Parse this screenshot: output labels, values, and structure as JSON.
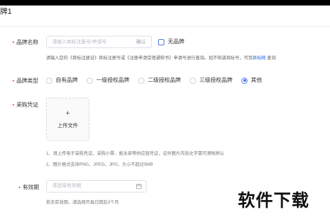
{
  "section": {
    "title": "牌1"
  },
  "brand_name": {
    "label": "品牌名称",
    "required": "•",
    "placeholder": "请输入商标注册号/申请号",
    "confirm_label": "确认",
    "no_brand_label": "无品牌",
    "help_text": "请输入您的《商标注册证》商标注册号或《注册申请受理通知书》申请号进行查询。如不知道商标号，可到",
    "help_link": "商标网",
    "help_suffix": " 查询"
  },
  "brand_type": {
    "label": "品牌类型",
    "required": "•",
    "options": [
      {
        "label": "自有品牌",
        "checked": false
      },
      {
        "label": "一级授权品牌",
        "checked": false
      },
      {
        "label": "二级授权品牌",
        "checked": false
      },
      {
        "label": "三级授权品牌",
        "checked": false
      },
      {
        "label": "其他",
        "checked": true
      }
    ]
  },
  "purchase_proof": {
    "label": "采购凭证",
    "required": "•",
    "upload_icon": "+",
    "upload_label": "上传文件",
    "notes": [
      "1、请上传电子采购凭证、采购小票、报关单等供应链凭证，证件图片内容文字需可清晰辨认",
      "2、图片格式支持PNG、JPEG、JPG，大小不超过5MB"
    ]
  },
  "validity": {
    "label": "有效期",
    "required": "•",
    "placeholder": "请选择有效期",
    "icon": "calendar-icon",
    "note": "若无有效期，请选择开具日期后3个月"
  },
  "watermark": "软件下载",
  "colors": {
    "accent": "#4b74f1",
    "required": "#e6453c",
    "link": "#2b6de5"
  }
}
